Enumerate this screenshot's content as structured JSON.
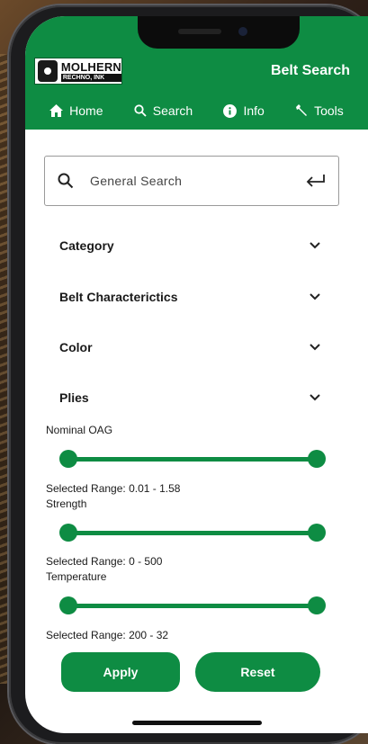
{
  "header": {
    "logo": {
      "main": "MOLHERN",
      "sub": "RECHNO, INK"
    },
    "title": "Belt Search",
    "nav": [
      {
        "label": "Home",
        "icon": "home-icon"
      },
      {
        "label": "Search",
        "icon": "search-icon"
      },
      {
        "label": "Info",
        "icon": "info-icon"
      },
      {
        "label": "Tools",
        "icon": "wrench-icon"
      }
    ]
  },
  "search": {
    "placeholder": "General Search"
  },
  "sections": [
    {
      "label": "Category"
    },
    {
      "label": "Belt Characterictics"
    },
    {
      "label": "Color"
    },
    {
      "label": "Plies"
    }
  ],
  "sliders": [
    {
      "label": "Nominal OAG",
      "range_text": "Selected Range: 0.01 - 1.58",
      "min": 0.01,
      "max": 1.58
    },
    {
      "label": "Strength",
      "range_text": "Selected Range: 0 - 500",
      "min": 0,
      "max": 500
    },
    {
      "label": "Temperature",
      "range_text": "Selected Range:  200 - 32",
      "min": 200,
      "max": 32
    }
  ],
  "buttons": {
    "apply": "Apply",
    "reset": "Reset"
  },
  "colors": {
    "accent": "#0e8c43",
    "background": "#ffffff"
  }
}
